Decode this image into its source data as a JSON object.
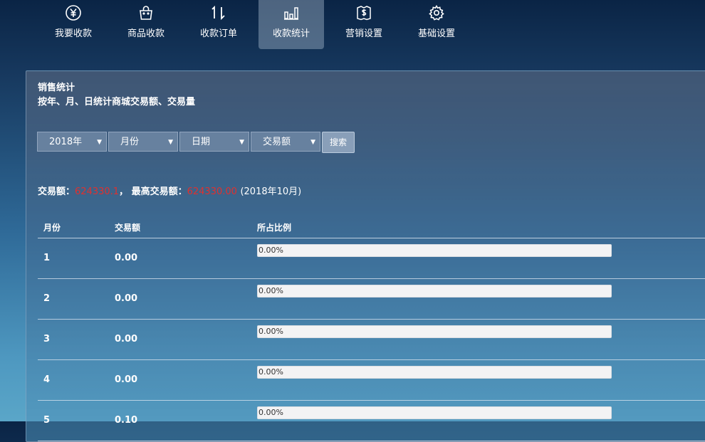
{
  "nav": {
    "items": [
      {
        "label": "我要收款",
        "icon": "yen-coin-icon"
      },
      {
        "label": "商品收款",
        "icon": "shopping-bag-icon"
      },
      {
        "label": "收款订单",
        "icon": "sort-arrows-icon"
      },
      {
        "label": "收款统计",
        "icon": "bar-chart-icon",
        "active": true
      },
      {
        "label": "营销设置",
        "icon": "coupon-icon"
      },
      {
        "label": "基础设置",
        "icon": "gear-icon"
      }
    ]
  },
  "panel": {
    "title": "销售统计",
    "subtitle": "按年、月、日统计商城交易额、交易量"
  },
  "filters": {
    "year": "2018年",
    "month": "月份",
    "day": "日期",
    "metric": "交易额",
    "search_label": "搜索"
  },
  "summary": {
    "amount_label": "交易额：",
    "amount_value": "624330.1",
    "separator": "，",
    "max_label": "最高交易额：",
    "max_value": "624330.00",
    "max_period": "(2018年10月)"
  },
  "table": {
    "headers": [
      "月份",
      "交易额",
      "所占比例"
    ],
    "rows": [
      {
        "month": "1",
        "amount": "0.00",
        "percent_text": "0.00%",
        "fraction": 0
      },
      {
        "month": "2",
        "amount": "0.00",
        "percent_text": "0.00%",
        "fraction": 0
      },
      {
        "month": "3",
        "amount": "0.00",
        "percent_text": "0.00%",
        "fraction": 0
      },
      {
        "month": "4",
        "amount": "0.00",
        "percent_text": "0.00%",
        "fraction": 0
      },
      {
        "month": "5",
        "amount": "0.10",
        "percent_text": "0.00%",
        "fraction": 0
      }
    ]
  },
  "colors": {
    "highlight_red": "#e0302f",
    "bar_background": "#f3f3f4"
  }
}
